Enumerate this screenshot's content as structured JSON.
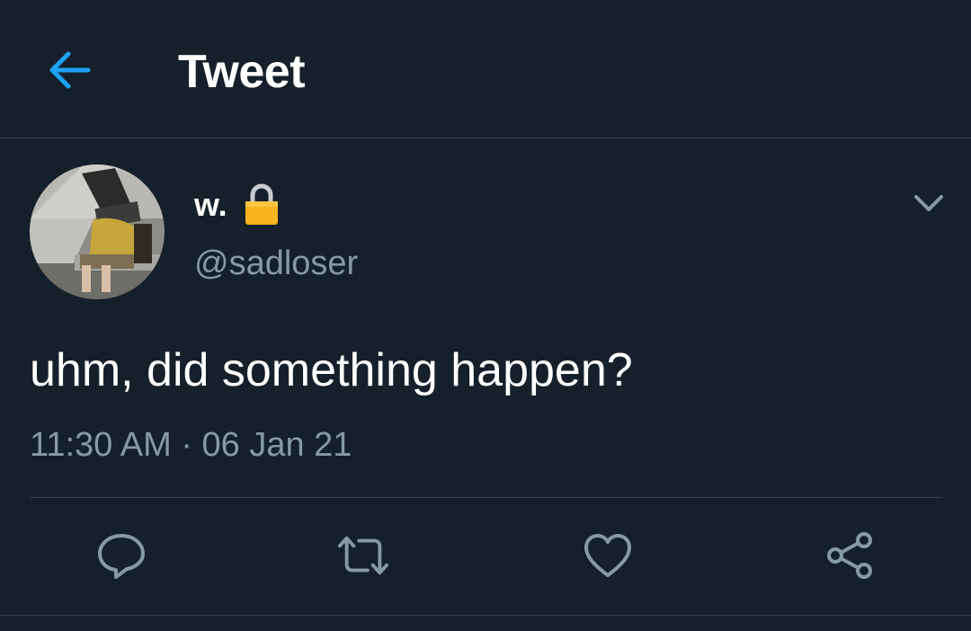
{
  "header": {
    "title": "Tweet",
    "back_icon": "arrow-left-icon"
  },
  "tweet": {
    "author": {
      "display_name": "w.",
      "handle": "@sadloser",
      "protected_icon": "lock-icon"
    },
    "text": "uhm, did something happen?",
    "timestamp": "11:30 AM · 06 Jan 21",
    "menu_icon": "chevron-down-icon"
  },
  "actions": {
    "reply_icon": "reply-icon",
    "retweet_icon": "retweet-icon",
    "like_icon": "heart-icon",
    "share_icon": "share-icon"
  },
  "colors": {
    "background": "#15202b",
    "accent": "#1da1f2",
    "secondary_text": "#8899a6",
    "divider": "#38444d",
    "lock": "#f9b31c"
  }
}
